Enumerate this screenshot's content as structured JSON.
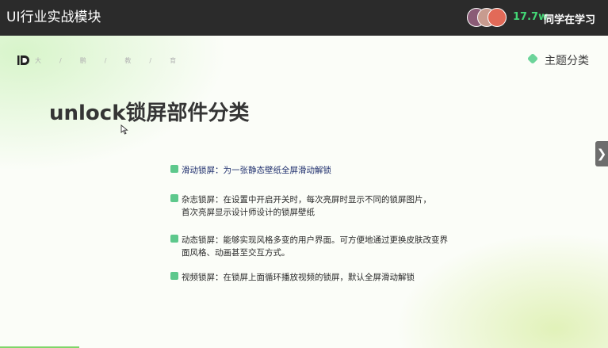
{
  "header": {
    "course_title": "UI行业实战模块",
    "viewer_count": "17.7w",
    "viewer_label": "同学在学习"
  },
  "slide": {
    "breadcrumb": [
      "大",
      "/",
      "鹏",
      "/",
      "教",
      "/",
      "育"
    ],
    "section_label": "主题分类",
    "title": "unlock锁屏部件分类",
    "bullets": [
      {
        "lines": [
          "滑动锁屏：为一张静态壁纸全屏滑动解锁"
        ]
      },
      {
        "lines": [
          "杂志锁屏：在设置中开启开关时，每次亮屏时显示不同的锁屏图片，",
          "首次亮屏显示设计师设计的锁屏壁纸"
        ]
      },
      {
        "lines": [
          "动态锁屏：能够实现风格多变的用户界面。可方便地通过更换皮肤改变界",
          "面风格、动画甚至交互方式。"
        ]
      },
      {
        "lines": [
          "视频锁屏：在锁屏上面循环播放视频的锁屏，默认全屏滑动解锁"
        ]
      }
    ]
  },
  "controls": {
    "next_icon": "chevron-right-icon",
    "next_glyph": "❯"
  },
  "colors": {
    "accent_green": "#5dc88c",
    "viewer_green": "#43d675",
    "first_bullet_text": "#1f2f6d"
  }
}
